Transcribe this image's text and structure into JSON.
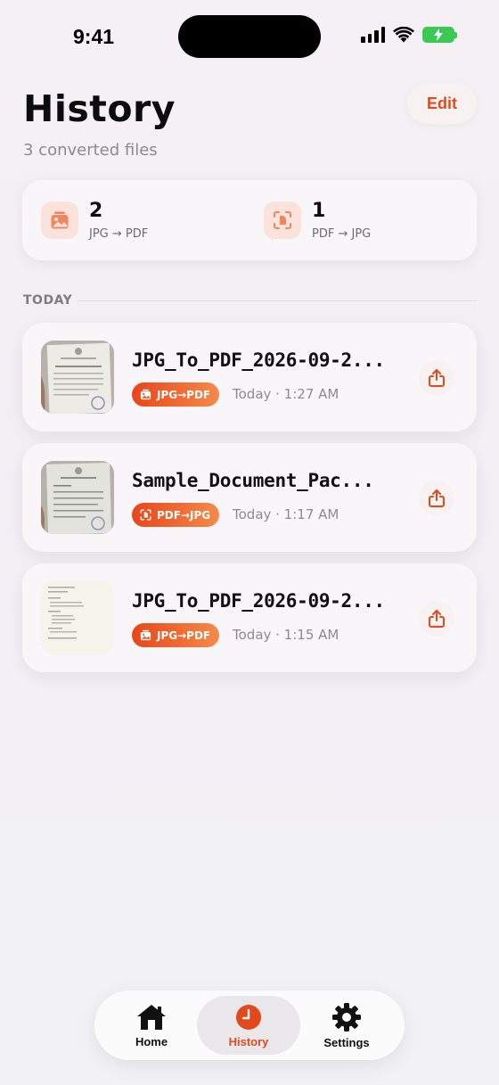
{
  "status_bar": {
    "time": "9:41"
  },
  "header": {
    "title": "History",
    "subtitle": "3 converted files",
    "edit_label": "Edit"
  },
  "summary": [
    {
      "count": "2",
      "label": "JPG → PDF",
      "icon": "image-icon"
    },
    {
      "count": "1",
      "label": "PDF → JPG",
      "icon": "scan-document-icon"
    }
  ],
  "section": {
    "label": "TODAY"
  },
  "files": [
    {
      "name": "JPG_To_PDF_2026-09-2...",
      "tag": "JPG→PDF",
      "tag_icon": "image-icon",
      "time": "Today · 1:27 AM"
    },
    {
      "name": "Sample_Document_Pac...",
      "tag": "PDF→JPG",
      "tag_icon": "scan-document-icon",
      "time": "Today · 1:17 AM"
    },
    {
      "name": "JPG_To_PDF_2026-09-2...",
      "tag": "JPG→PDF",
      "tag_icon": "image-icon",
      "time": "Today · 1:15 AM"
    }
  ],
  "tabbar": {
    "tabs": [
      {
        "label": "Home",
        "icon": "home-icon"
      },
      {
        "label": "History",
        "icon": "clock-icon",
        "active": true
      },
      {
        "label": "Settings",
        "icon": "gear-icon"
      }
    ]
  },
  "colors": {
    "accent": "#e24a1b",
    "accent_light": "#f58a4a",
    "icon_bg": "#fbe3dc",
    "battery": "#3bc954"
  }
}
